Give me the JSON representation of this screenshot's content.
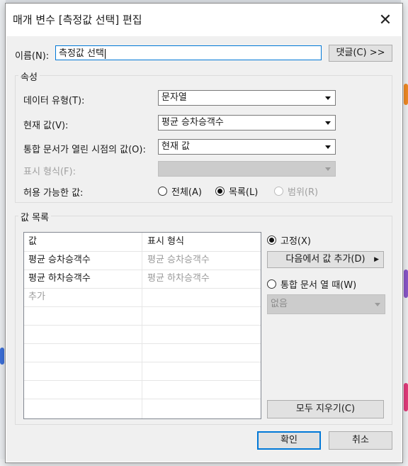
{
  "dialog": {
    "title": "매개 변수 [측정값 선택] 편집",
    "close_glyph": "✕"
  },
  "name": {
    "label": "이름(N):",
    "value": "측정값 선택",
    "comment_button": "댓글(C) >>"
  },
  "properties": {
    "group_title": "속성",
    "data_type": {
      "label": "데이터 유형(T):",
      "value": "문자열"
    },
    "current_value": {
      "label": "현재 값(V):",
      "value": "평균 승차승객수"
    },
    "workbook_open_value": {
      "label": "통합 문서가 열린 시점의 값(O):",
      "value": "현재 값"
    },
    "display_format": {
      "label": "표시 형식(F):",
      "value": ""
    },
    "allowable_values": {
      "label": "허용 가능한 값:",
      "options": [
        {
          "label": "전체(A)",
          "selected": false,
          "disabled": false
        },
        {
          "label": "목록(L)",
          "selected": true,
          "disabled": false
        },
        {
          "label": "범위(R)",
          "selected": false,
          "disabled": true
        }
      ]
    }
  },
  "value_list": {
    "group_title": "값 목록",
    "headers": [
      "값",
      "표시 형식"
    ],
    "rows": [
      [
        "평균 승차승객수",
        "평균 승차승객수"
      ],
      [
        "평균 하차승객수",
        "평균 하차승객수"
      ]
    ],
    "add_placeholder": "추가",
    "fixed_radio": "고정(X)",
    "add_from_button": "다음에서 값 추가(D)",
    "on_open_radio": "통합 문서 열 때(W)",
    "on_open_select": "없음",
    "clear_all_button": "모두 지우기(C)"
  },
  "footer": {
    "ok": "확인",
    "cancel": "취소"
  },
  "colors": {
    "focus_blue": "#0078d7",
    "disabled_fill": "#cccccc"
  }
}
